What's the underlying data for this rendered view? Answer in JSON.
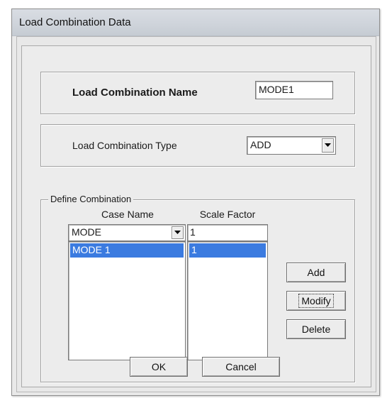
{
  "window": {
    "title": "Load Combination Data"
  },
  "name_section": {
    "label": "Load Combination Name",
    "value": "MODE1"
  },
  "type_section": {
    "label": "Load Combination Type",
    "selected": "ADD"
  },
  "define_combination": {
    "group_title": "Define Combination",
    "case_name_header": "Case Name",
    "scale_factor_header": "Scale Factor",
    "case_name_selected": "MODE",
    "scale_factor_value": "1",
    "rows": [
      {
        "case_name": "MODE 1",
        "scale_factor": "1"
      }
    ],
    "selection_color": "#3b7be0"
  },
  "buttons": {
    "add": "Add",
    "modify": "Modify",
    "delete": "Delete",
    "ok": "OK",
    "cancel": "Cancel"
  }
}
